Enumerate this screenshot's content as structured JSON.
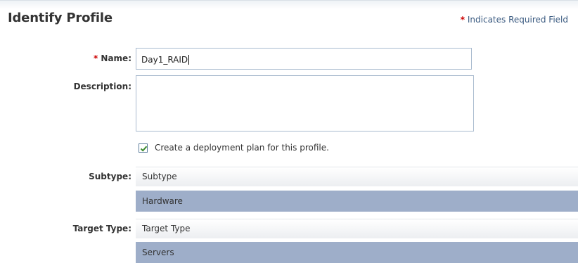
{
  "section": {
    "title": "Identify Profile",
    "required_star": "*",
    "required_note": "Indicates Required Field"
  },
  "form": {
    "name_star": "*",
    "name_label": "Name:",
    "name_value": "Day1_RAID",
    "description_label": "Description:",
    "description_value": "",
    "deployment_checkbox_checked": true,
    "deployment_checkbox_label": "Create a deployment plan for this profile.",
    "subtype_label": "Subtype:",
    "subtype_header": "Subtype",
    "subtype_selected": "Hardware",
    "target_type_label": "Target Type:",
    "target_type_header": "Target Type",
    "target_type_selected": "Servers"
  },
  "colors": {
    "required_star": "#cc0000",
    "selected_row": "#9eaec9",
    "input_border": "#a9bbcf",
    "checkmark": "#3c8a2e"
  },
  "icons": {
    "checkbox": "checkmark-icon"
  }
}
